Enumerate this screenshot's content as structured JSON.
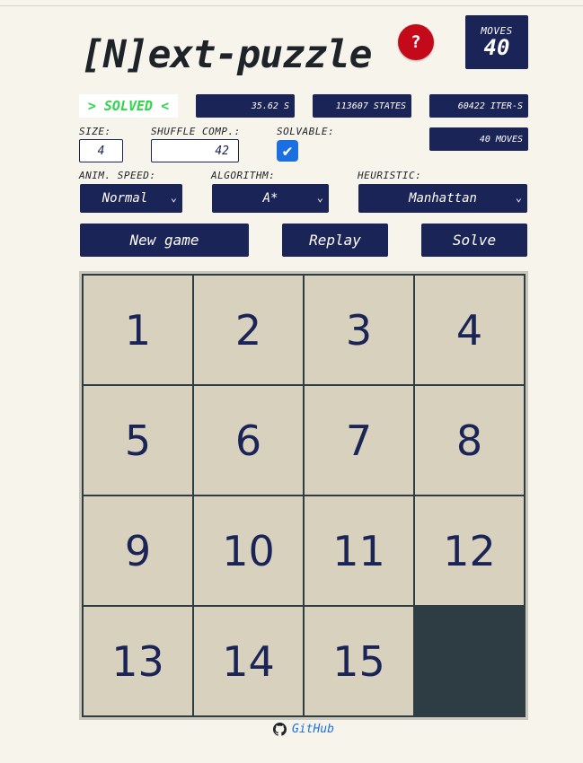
{
  "header": {
    "title": "[N]ext-puzzle",
    "help_label": "?",
    "moves_label": "MOVES",
    "moves_value": "40"
  },
  "status": {
    "solved_text": "> SOLVED <",
    "time": "35.62 S",
    "states": "113607 STATES",
    "iterations": "60422 ITER-S",
    "moves": "40 MOVES"
  },
  "settings": {
    "size_label": "SIZE:",
    "size_value": "4",
    "shuffle_label": "SHUFFLE COMP.:",
    "shuffle_value": "42",
    "solvable_label": "SOLVABLE:",
    "solvable_checked": true,
    "anim_speed_label": "ANIM. SPEED:",
    "anim_speed_value": "Normal",
    "algorithm_label": "ALGORITHM:",
    "algorithm_value": "A*",
    "heuristic_label": "HEURISTIC:",
    "heuristic_value": "Manhattan"
  },
  "actions": {
    "new_game": "New game",
    "replay": "Replay",
    "solve": "Solve"
  },
  "board": {
    "tiles": [
      "1",
      "2",
      "3",
      "4",
      "5",
      "6",
      "7",
      "8",
      "9",
      "10",
      "11",
      "12",
      "13",
      "14",
      "15",
      ""
    ]
  },
  "footer": {
    "github_label": "GitHub"
  },
  "colors": {
    "primary": "#1b2456",
    "solved_green": "#2fd64a",
    "help_red": "#c4091b",
    "tile_bg": "#d7d1be",
    "empty_tile": "#2e3c43",
    "link_blue": "#1b6fe0"
  }
}
